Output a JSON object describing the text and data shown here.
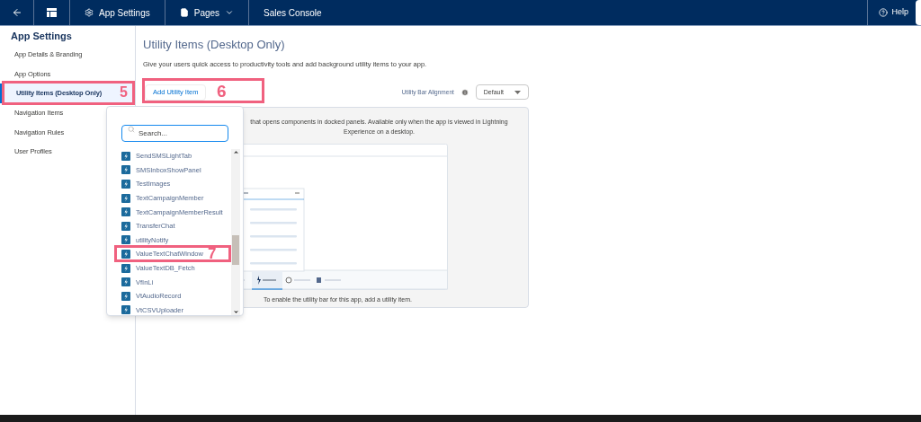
{
  "top_bar": {
    "items": [
      {
        "kind": "back"
      },
      {
        "kind": "layout"
      },
      {
        "kind": "gear",
        "label": "App Settings"
      },
      {
        "kind": "menu",
        "label": "Pages"
      },
      {
        "kind": "plain",
        "label": "Sales Console"
      }
    ],
    "help": "Help"
  },
  "sidebar": {
    "title": "App Settings",
    "items": [
      {
        "label": "App Details & Branding",
        "selected": false
      },
      {
        "label": "App Options",
        "selected": false
      },
      {
        "label": "Utility Items (Desktop Only)",
        "selected": true,
        "annotation": "5"
      },
      {
        "label": "Navigation Items",
        "selected": false
      },
      {
        "label": "Navigation Rules",
        "selected": false
      },
      {
        "label": "User Profiles",
        "selected": false
      }
    ]
  },
  "main": {
    "title": "Utility Items (Desktop Only)",
    "description": "Give your users quick access to productivity tools and add background utility items to your app.",
    "add_button": {
      "label": "Add Utility Item",
      "annotation": "6"
    },
    "alignment_label": "Utility Bar Alignment",
    "alignment_value": "Default",
    "panel_lines": [
      "that opens components in docked panels. Available only when the app is viewed in Lightning",
      "Experience on a desktop."
    ],
    "panel_footer": "To enable the utility bar for this app, add a utility item."
  },
  "dropdown": {
    "search_placeholder": "Search...",
    "items": [
      {
        "label": "SendSMSLightTab"
      },
      {
        "label": "SMSInboxShowPanel"
      },
      {
        "label": "TestImages"
      },
      {
        "label": "TextCampaignMember"
      },
      {
        "label": "TextCampaignMemberResult"
      },
      {
        "label": "TransferChat"
      },
      {
        "label": "utilityNotify"
      },
      {
        "label": "ValueTextChatWindow",
        "annotation": "7"
      },
      {
        "label": "ValueTextDB_Fetch"
      },
      {
        "label": "VfInLi"
      },
      {
        "label": "VtAudioRecord"
      },
      {
        "label": "VtCSVUploader"
      }
    ]
  }
}
